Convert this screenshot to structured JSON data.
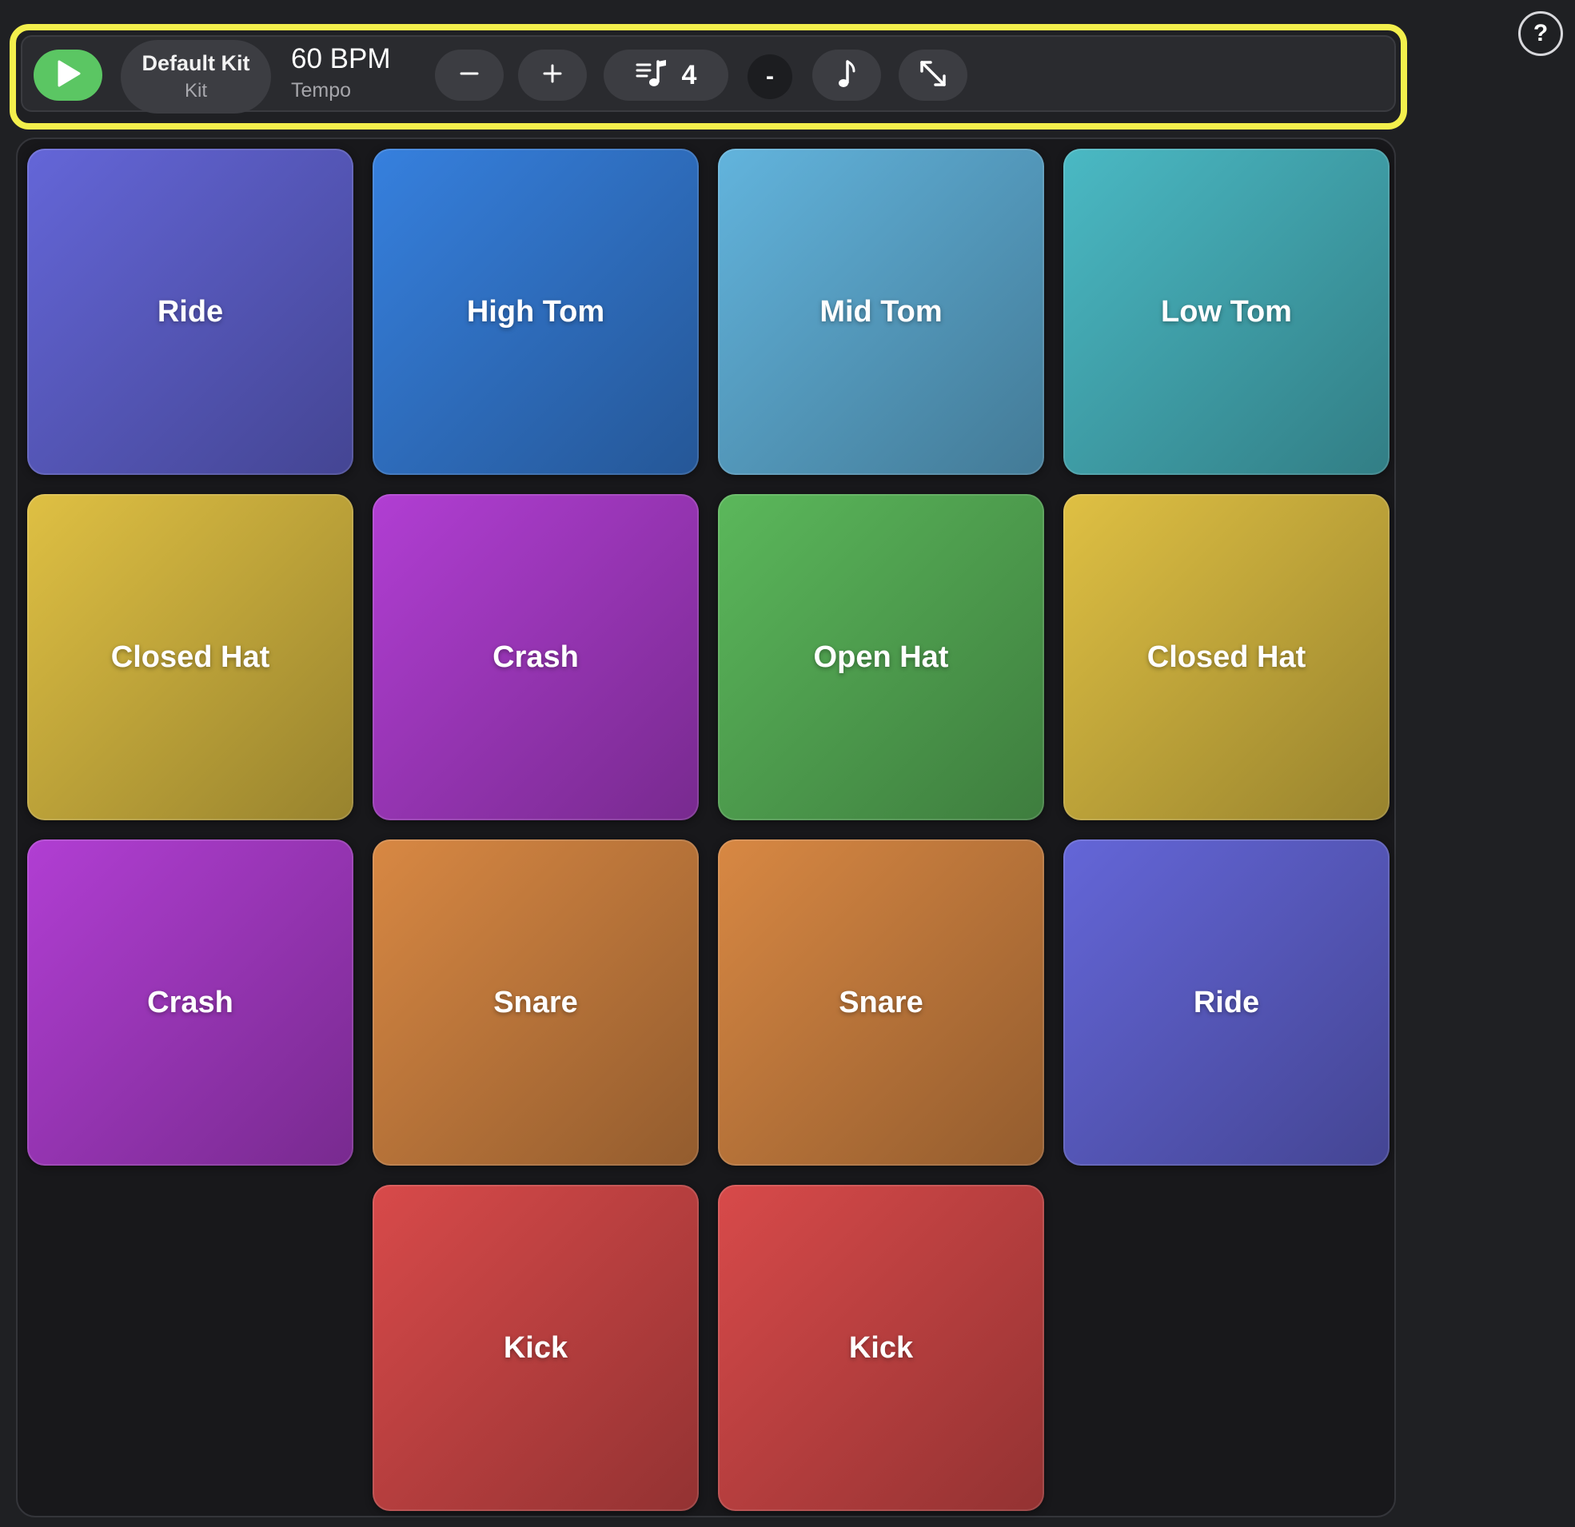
{
  "toolbar": {
    "play_icon": "play-icon",
    "kit_name": "Default Kit",
    "kit_label": "Kit",
    "tempo_value": "60 BPM",
    "tempo_label": "Tempo",
    "decrease_label": "–",
    "increase_label": "+",
    "beats_icon": "beats-per-bar-icon",
    "beats_count": "4",
    "dash_label": "-",
    "note_icon": "music-note-icon",
    "expand_icon": "expand-arrows-icon"
  },
  "help": {
    "label": "?"
  },
  "colors": {
    "play": "#5bc663",
    "highlight": "#f3ef4c",
    "purple_blue": "#6466d8",
    "blue": "#3680de",
    "light_blue": "#62b4dd",
    "teal": "#4ab9c4",
    "yellow": "#dfc043",
    "violet": "#b13ed3",
    "green": "#5bb85b",
    "orange": "#d88843",
    "red": "#d84a4a"
  },
  "pads": [
    {
      "label": "Ride",
      "color": "purple_blue"
    },
    {
      "label": "High Tom",
      "color": "blue"
    },
    {
      "label": "Mid Tom",
      "color": "light_blue"
    },
    {
      "label": "Low Tom",
      "color": "teal"
    },
    {
      "label": "Closed Hat",
      "color": "yellow"
    },
    {
      "label": "Crash",
      "color": "violet"
    },
    {
      "label": "Open Hat",
      "color": "green"
    },
    {
      "label": "Closed Hat",
      "color": "yellow"
    },
    {
      "label": "Crash",
      "color": "violet"
    },
    {
      "label": "Snare",
      "color": "orange"
    },
    {
      "label": "Snare",
      "color": "orange"
    },
    {
      "label": "Ride",
      "color": "purple_blue"
    },
    {
      "label": "",
      "color": ""
    },
    {
      "label": "Kick",
      "color": "red"
    },
    {
      "label": "Kick",
      "color": "red"
    },
    {
      "label": "",
      "color": ""
    }
  ]
}
